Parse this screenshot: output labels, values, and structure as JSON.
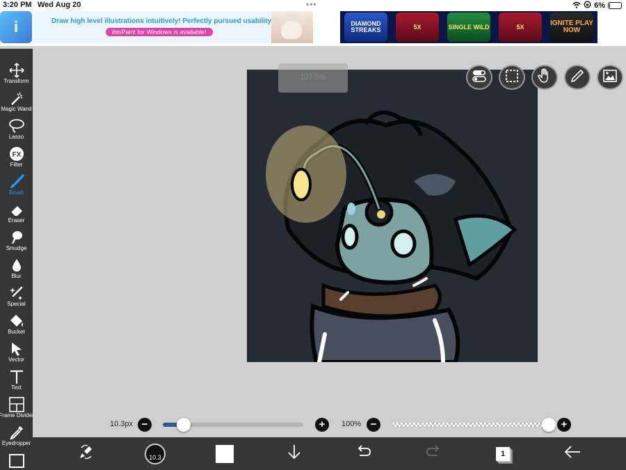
{
  "status_bar": {
    "time": "3:20 PM",
    "date": "Wed Aug 20",
    "multitask_dots": "•••",
    "battery_percent": "6%",
    "battery_level": 0.06
  },
  "ad": {
    "headline": "Draw high level illustrations intuitively! Perfectly pursued usability!",
    "subline": "ibisPaint for Windows is available!",
    "logo_text": "i",
    "slot_tiles": [
      "DIAMOND STREAKS",
      "5X",
      "SINGLE WILD",
      "5X",
      "IGNITE PLAY NOW"
    ]
  },
  "toolbar": {
    "tools": [
      {
        "label": "Transform",
        "icon": "move-arrows-icon"
      },
      {
        "label": "Magic Wand",
        "icon": "magic-wand-icon"
      },
      {
        "label": "Lasso",
        "icon": "lasso-icon"
      },
      {
        "label": "Filter",
        "icon": "fx-icon"
      },
      {
        "label": "Brush",
        "icon": "brush-icon"
      },
      {
        "label": "Eraser",
        "icon": "eraser-icon"
      },
      {
        "label": "Smudge",
        "icon": "smudge-icon"
      },
      {
        "label": "Blur",
        "icon": "drop-icon"
      },
      {
        "label": "Special",
        "icon": "special-pen-icon"
      },
      {
        "label": "Bucket",
        "icon": "bucket-icon"
      },
      {
        "label": "Vector",
        "icon": "cursor-arrow-icon"
      },
      {
        "label": "Text",
        "icon": "text-t-icon"
      },
      {
        "label": "Frame Divider",
        "icon": "frame-divider-icon"
      },
      {
        "label": "Eyedropper",
        "icon": "eyedropper-icon"
      }
    ],
    "active_tool": "Brush",
    "accent_color": "#1e9bff"
  },
  "canvas": {
    "zoom_label": "107.5%"
  },
  "sliders": {
    "brush_size_label": "10.3px",
    "brush_size_fraction": 0.15,
    "opacity_label": "100%",
    "opacity_fraction": 1.0,
    "minus_symbol": "−",
    "plus_symbol": "+"
  },
  "bottom_bar": {
    "brush_size_value": "10.3",
    "layer_count": "1",
    "current_color": "#ffffff"
  }
}
